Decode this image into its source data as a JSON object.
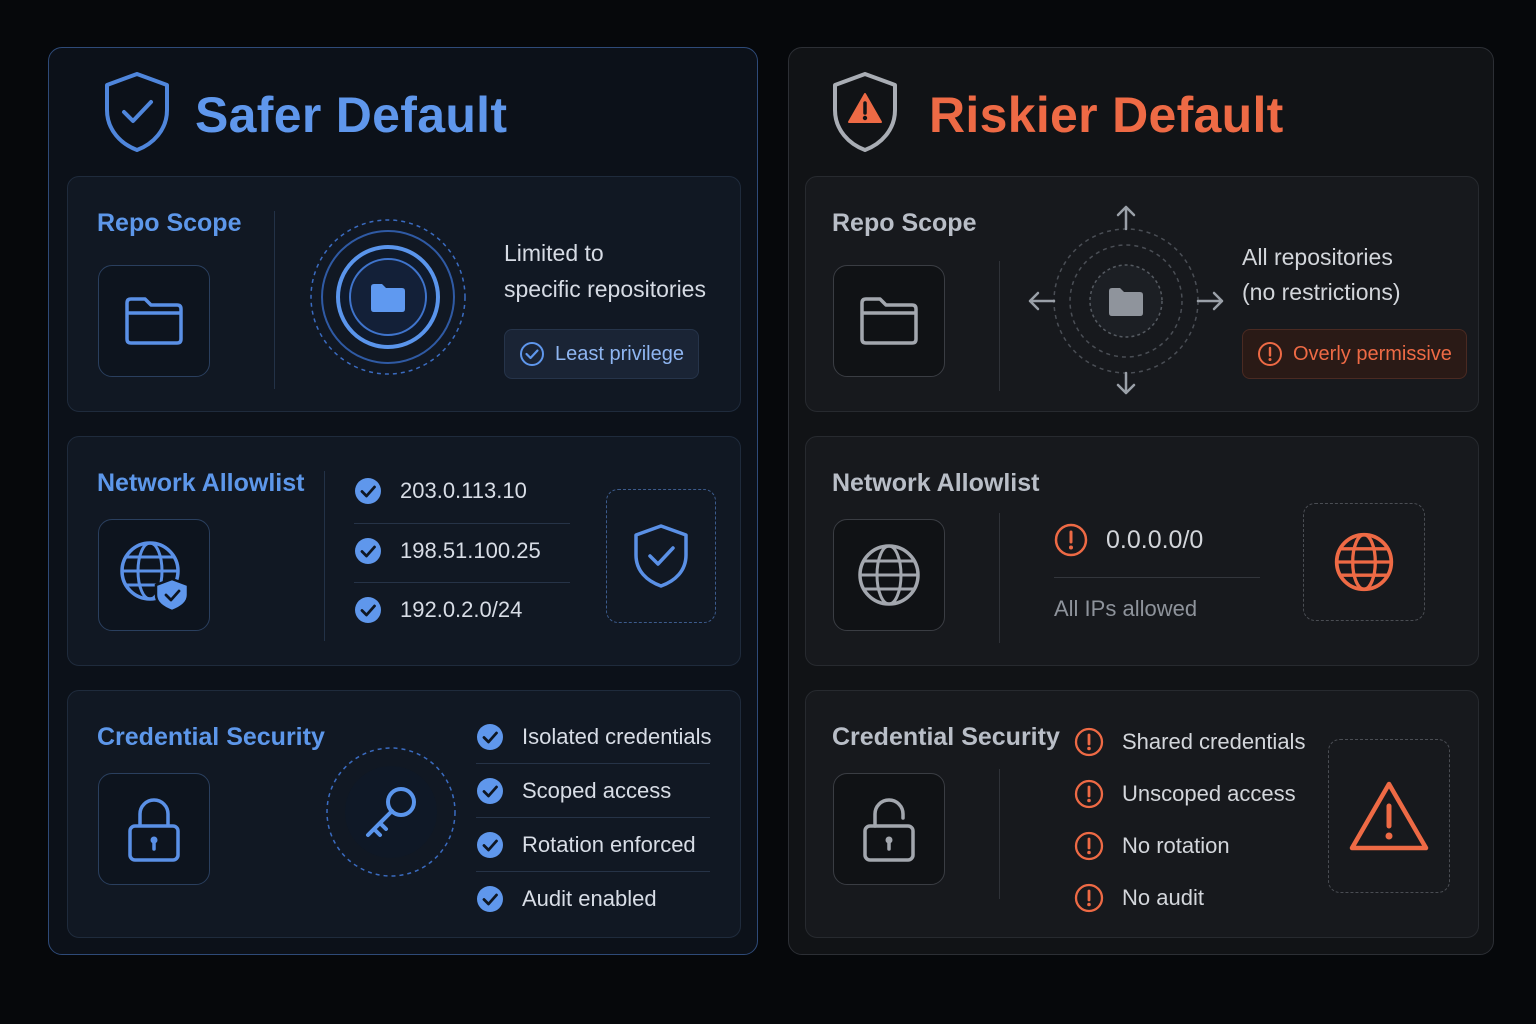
{
  "colors": {
    "safe_accent": "#5f97ec",
    "risk_accent": "#ee6a45",
    "background": "#06080b"
  },
  "safer": {
    "title": "Safer Default",
    "icon": "shield-check-icon",
    "repo_scope": {
      "label": "Repo Scope",
      "description_line1": "Limited to",
      "description_line2": "specific repositories",
      "badge": "Least privilege"
    },
    "network_allowlist": {
      "label": "Network Allowlist",
      "entries": [
        "203.0.113.10",
        "198.51.100.25",
        "192.0.2.0/24"
      ]
    },
    "credential_security": {
      "label": "Credential Security",
      "items": [
        "Isolated credentials",
        "Scoped access",
        "Rotation enforced",
        "Audit enabled"
      ]
    }
  },
  "riskier": {
    "title": "Riskier Default",
    "icon": "shield-warning-icon",
    "repo_scope": {
      "label": "Repo Scope",
      "description_line1": "All repositories",
      "description_line2": "(no restrictions)",
      "badge": "Overly permissive"
    },
    "network_allowlist": {
      "label": "Network Allowlist",
      "entry": "0.0.0.0/0",
      "note": "All IPs allowed"
    },
    "credential_security": {
      "label": "Credential Security",
      "items": [
        "Shared credentials",
        "Unscoped access",
        "No rotation",
        "No audit"
      ]
    }
  }
}
